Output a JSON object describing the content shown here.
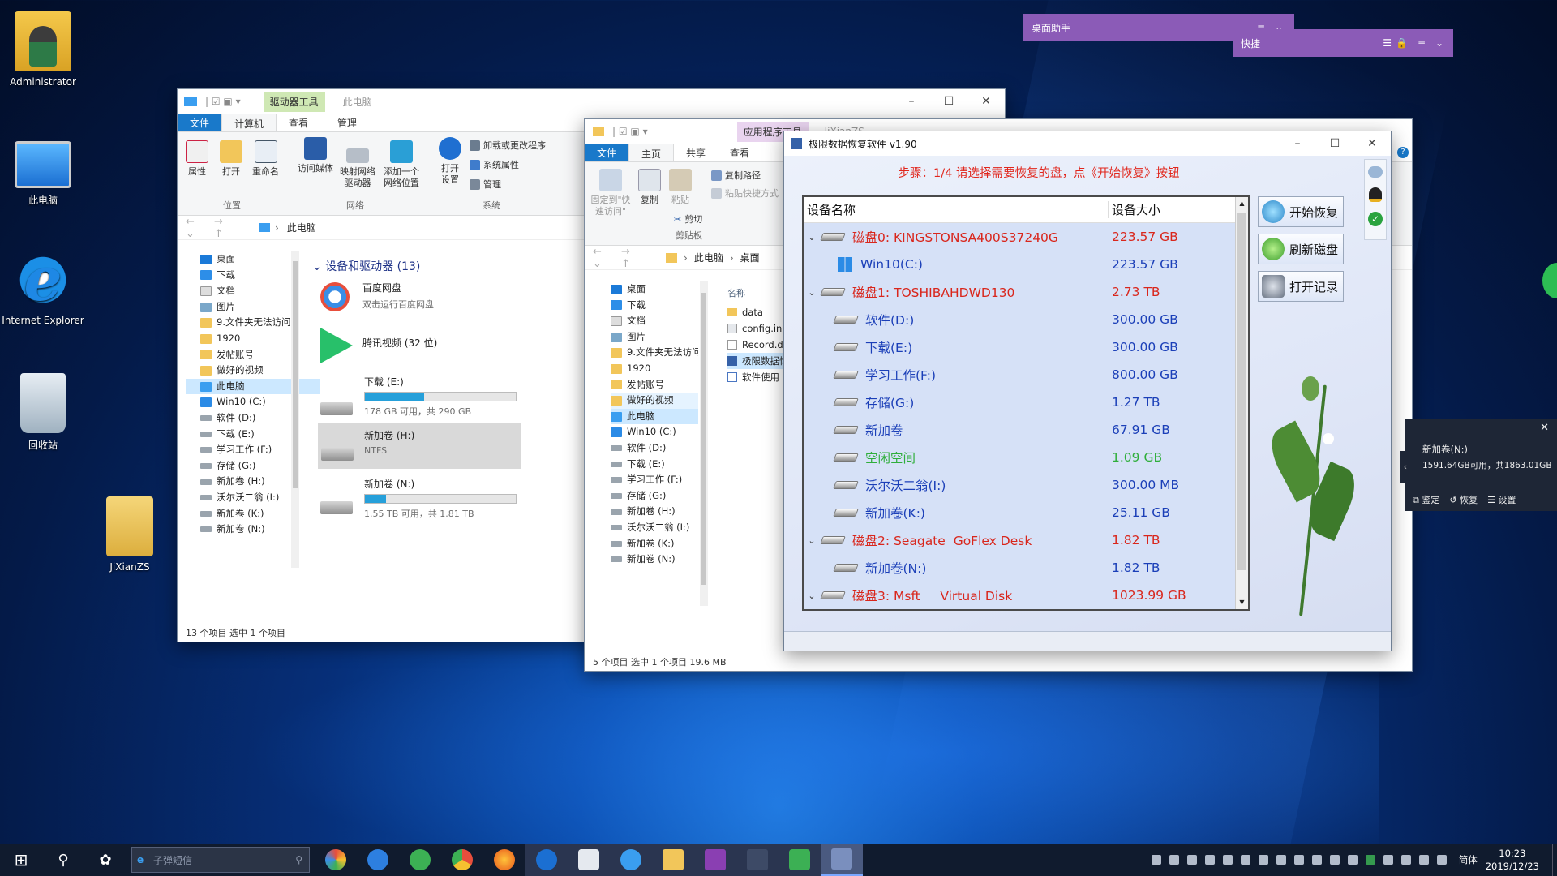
{
  "desktop": {
    "icons": [
      {
        "label": "Administrator"
      },
      {
        "label": "此电脑"
      },
      {
        "label": "Internet Explorer"
      },
      {
        "label": "回收站"
      },
      {
        "label": "JiXianZS"
      }
    ]
  },
  "explorer1": {
    "tabs": [
      "文件",
      "计算机",
      "查看",
      "管理"
    ],
    "context_tab": "驱动器工具",
    "window_title": "此电脑",
    "ribbon": {
      "attr": "属性",
      "open": "打开",
      "rename": "重命名",
      "media": "访问媒体",
      "mapdrive": "映射网络\n驱动器",
      "addloc": "添加一个\n网络位置",
      "settings": "打开\n设置",
      "uninstall": "卸载或更改程序",
      "sysprop": "系统属性",
      "manage": "管理",
      "groups": [
        "位置",
        "网络",
        "系统"
      ]
    },
    "breadcrumb": "此电脑",
    "section": "设备和驱动器 (13)",
    "tree": [
      "桌面",
      "下载",
      "文档",
      "图片",
      "9.文件夹无法访问",
      "1920",
      "发帖账号",
      "做好的视频",
      "此电脑",
      "Win10 (C:)",
      "软件 (D:)",
      "下载 (E:)",
      "学习工作 (F:)",
      "存储 (G:)",
      "新加卷 (H:)",
      "沃尔沃二翁 (I:)",
      "新加卷 (K:)",
      "新加卷 (N:)"
    ],
    "tiles": {
      "baidu_name": "百度网盘",
      "baidu_sub": "双击运行百度网盘",
      "tencent": "腾讯视频 (32 位)",
      "e_name": "下载 (E:)",
      "e_space": "178 GB 可用，共 290 GB",
      "e_used": 0.39,
      "h_name": "新加卷 (H:)",
      "h_fs": "NTFS",
      "n_name": "新加卷 (N:)",
      "n_space": "1.55 TB 可用，共 1.81 TB",
      "n_used": 0.14
    },
    "status": "13 个项目    选中 1 个项目"
  },
  "explorer2": {
    "tabs": [
      "文件",
      "主页",
      "共享",
      "查看"
    ],
    "context_tab": "应用程序工具",
    "window_title": "JiXianZS",
    "ribbon": {
      "pin": "固定到\"快\n速访问\"",
      "copy": "复制",
      "paste": "粘贴",
      "copypath": "复制路径",
      "pasteshortcut": "粘贴快捷方式",
      "cut": "剪切",
      "group": "剪贴板"
    },
    "breadcrumb_a": "此电脑",
    "breadcrumb_b": "桌面",
    "tree": [
      "桌面",
      "下载",
      "文档",
      "图片",
      "9.文件夹无法访问",
      "1920",
      "发帖账号",
      "做好的视频",
      "此电脑",
      "Win10 (C:)",
      "软件 (D:)",
      "下载 (E:)",
      "学习工作 (F:)",
      "存储 (G:)",
      "新加卷 (H:)",
      "沃尔沃二翁 (I:)",
      "新加卷 (K:)",
      "新加卷 (N:)"
    ],
    "col_name": "名称",
    "files": [
      "data",
      "config.ini",
      "Record.dat",
      "极限数据恢复",
      "软件使用"
    ],
    "status": "5 个项目    选中 1 个项目  19.6 MB"
  },
  "recovery": {
    "title": "极限数据恢复软件 v1.90",
    "steps": "步骤：1/4 请选择需要恢复的盘，点《开始恢复》按钮",
    "col_name": "设备名称",
    "col_size": "设备大小",
    "rows": [
      {
        "name": "磁盘0: KINGSTONSA400S37240G",
        "size": "223.57 GB",
        "level": 0,
        "color": "#d9261c"
      },
      {
        "name": "Win10(C:)",
        "size": "223.57 GB",
        "level": 1,
        "color": "#1b3fb8",
        "win": true
      },
      {
        "name": "磁盘1: TOSHIBAHDWD130",
        "size": "2.73 TB",
        "level": 0,
        "color": "#d9261c"
      },
      {
        "name": "软件(D:)",
        "size": "300.00 GB",
        "level": 1,
        "color": "#1b3fb8"
      },
      {
        "name": "下载(E:)",
        "size": "300.00 GB",
        "level": 1,
        "color": "#1b3fb8"
      },
      {
        "name": "学习工作(F:)",
        "size": "800.00 GB",
        "level": 1,
        "color": "#1b3fb8"
      },
      {
        "name": "存储(G:)",
        "size": "1.27 TB",
        "level": 1,
        "color": "#1b3fb8"
      },
      {
        "name": "新加卷",
        "size": "67.91 GB",
        "level": 1,
        "color": "#1b3fb8"
      },
      {
        "name": "空闲空间",
        "size": "1.09 GB",
        "level": 1,
        "color": "#2fae3b"
      },
      {
        "name": "沃尔沃二翁(I:)",
        "size": "300.00 MB",
        "level": 1,
        "color": "#1b3fb8"
      },
      {
        "name": "新加卷(K:)",
        "size": "25.11 GB",
        "level": 1,
        "color": "#1b3fb8"
      },
      {
        "name": "磁盘2: Seagate  GoFlex Desk",
        "size": "1.82 TB",
        "level": 0,
        "color": "#d9261c"
      },
      {
        "name": "新加卷(N:)",
        "size": "1.82 TB",
        "level": 1,
        "color": "#1b3fb8"
      },
      {
        "name": "磁盘3: Msft     Virtual Disk",
        "size": "1023.99 GB",
        "level": 0,
        "color": "#d9261c"
      }
    ],
    "buttons": {
      "start": "开始恢复",
      "refresh": "刷新磁盘",
      "record": "打开记录"
    }
  },
  "widgets": {
    "desk_assistant": "桌面助手",
    "quick": "快捷",
    "popup_title": "新加卷(N:)",
    "popup_space": "1591.64GB可用，共1863.01GB",
    "popup_actions": [
      "鉴定",
      "恢复",
      "设置"
    ]
  },
  "taskbar": {
    "search_placeholder": "子弹短信",
    "ime": "简体",
    "time": "10:23",
    "date": "2019/12/23"
  }
}
